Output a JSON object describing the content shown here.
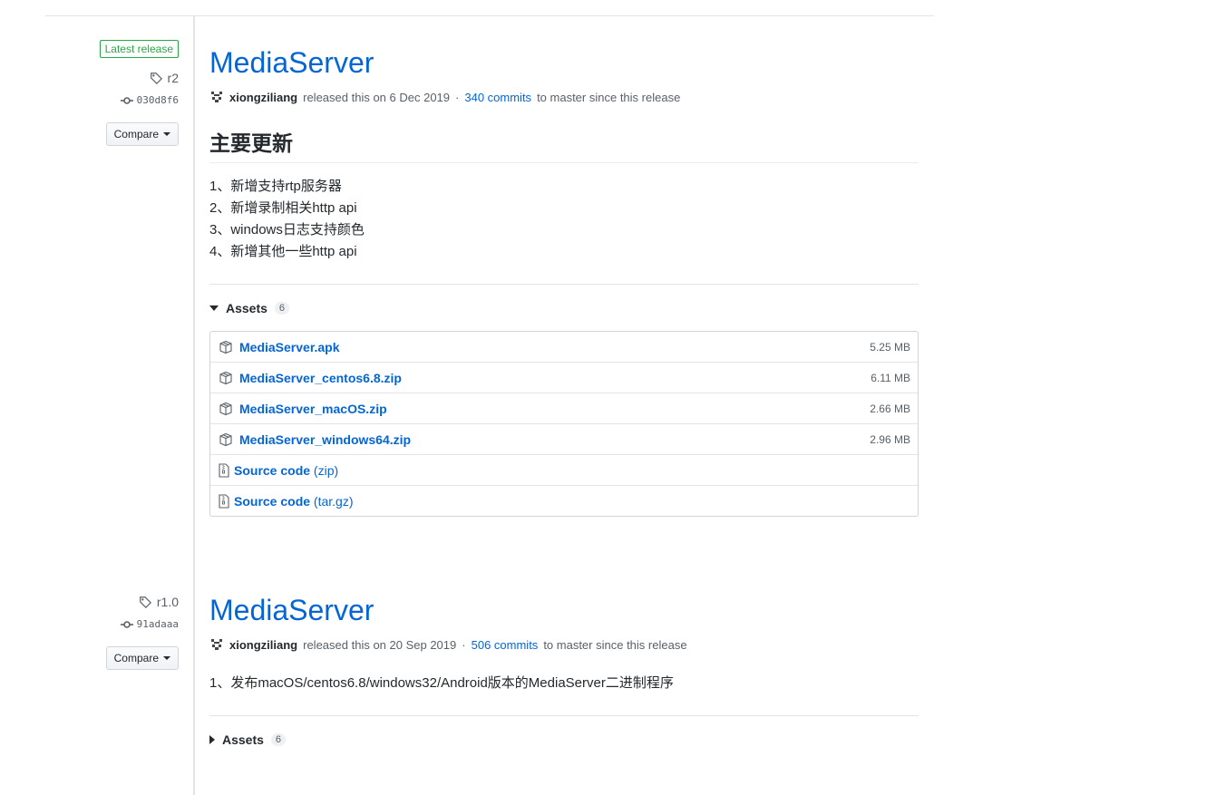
{
  "releases": [
    {
      "latest_label": "Latest release",
      "tag": "r2",
      "commit": "030d8f6",
      "compare_label": "Compare",
      "title": "MediaServer",
      "author": "xiongziliang",
      "released_text": "released this on 6 Dec 2019",
      "separator": "·",
      "commits_link": "340 commits",
      "commits_suffix": "to master since this release",
      "section_heading": "主要更新",
      "notes": [
        "1、新增支持rtp服务器",
        "2、新增录制相关http api",
        "3、windows日志支持颜色",
        "4、新增其他一些http api"
      ],
      "assets_label": "Assets",
      "assets_count": "6",
      "assets_expanded": true,
      "assets": [
        {
          "name": "MediaServer.apk",
          "size": "5.25 MB",
          "icon": "package-icon"
        },
        {
          "name": "MediaServer_centos6.8.zip",
          "size": "6.11 MB",
          "icon": "package-icon"
        },
        {
          "name": "MediaServer_macOS.zip",
          "size": "2.66 MB",
          "icon": "package-icon"
        },
        {
          "name": "MediaServer_windows64.zip",
          "size": "2.96 MB",
          "icon": "package-icon"
        },
        {
          "name": "Source code",
          "suffix": "(zip)",
          "icon": "file-zip-icon"
        },
        {
          "name": "Source code",
          "suffix": "(tar.gz)",
          "icon": "file-zip-icon"
        }
      ]
    },
    {
      "tag": "r1.0",
      "commit": "91adaaa",
      "compare_label": "Compare",
      "title": "MediaServer",
      "author": "xiongziliang",
      "released_text": "released this on 20 Sep 2019",
      "separator": "·",
      "commits_link": "506 commits",
      "commits_suffix": "to master since this release",
      "notes": [
        "1、发布macOS/centos6.8/windows32/Android版本的MediaServer二进制程序"
      ],
      "assets_label": "Assets",
      "assets_count": "6",
      "assets_expanded": false
    }
  ],
  "colors": {
    "link": "#0366d6",
    "latest_badge": "#28a745",
    "muted": "#586069",
    "border": "#e1e4e8"
  }
}
